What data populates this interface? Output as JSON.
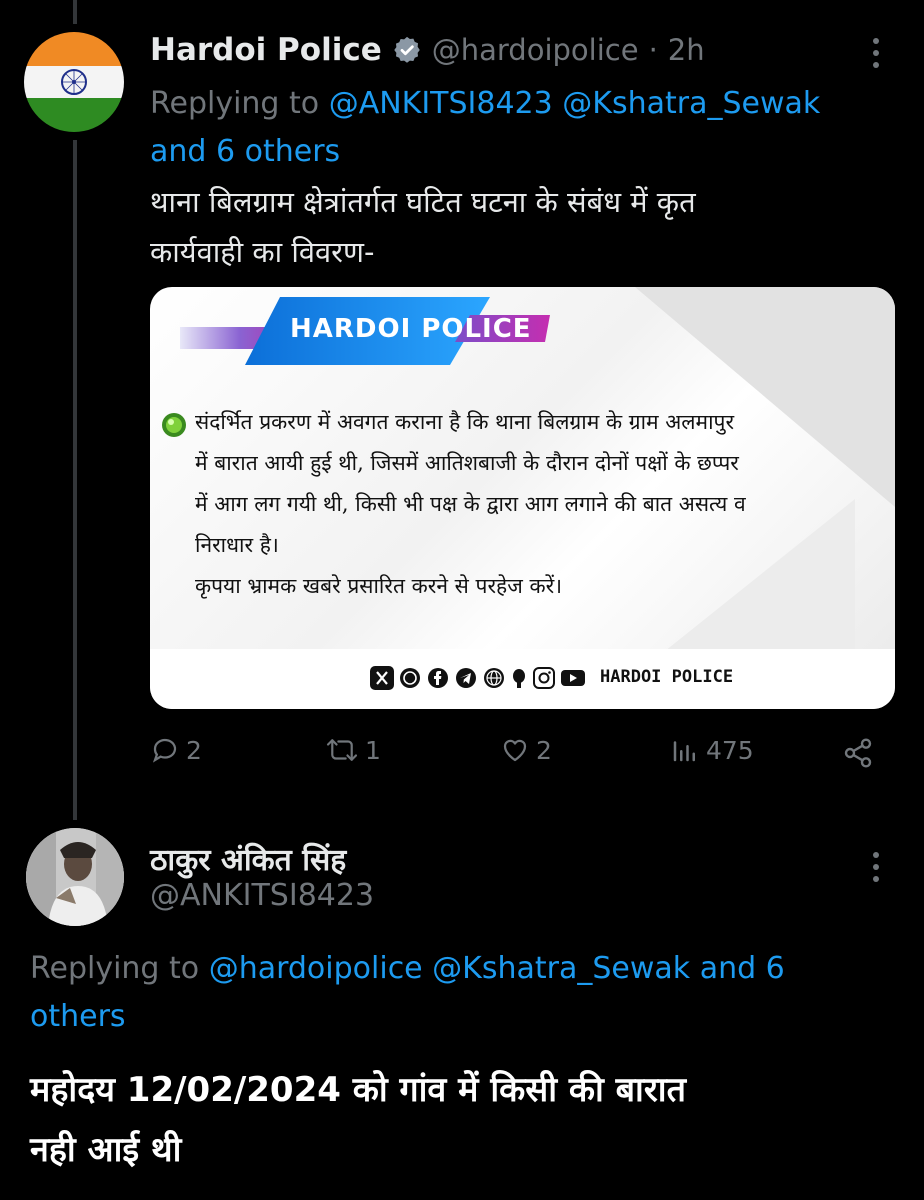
{
  "tweet1": {
    "display_name": "Hardoi Police",
    "handle": "@hardoipolice",
    "separator": "·",
    "time": "2h",
    "replying_prefix": "Replying to",
    "reply_line1": "@ANKITSI8423 @Kshatra_Sewak",
    "reply_line2": "and 6 others",
    "text_line1": "थाना बिलग्राम क्षेत्रांतर्गत घटित घटना के संबंध में कृत",
    "text_line2": "कार्यवाही का विवरण-",
    "card": {
      "banner": "HARDOI POLICE",
      "lines": [
        "संदर्भित प्रकरण में अवगत कराना है कि थाना बिलग्राम के ग्राम अलमापुर",
        "में बारात आयी हुई थी, जिसमें आतिशबाजी के दौरान दोनों पक्षों के छप्पर",
        "में आग लग गयी थी, किसी भी पक्ष के द्वारा आग लगाने की बात असत्य व",
        "निराधार है।",
        "कृपया भ्रामक खबरे प्रसारित करने से परहेज करें।"
      ],
      "footer_label": "HARDOI POLICE",
      "footer_icons": [
        "x-icon",
        "whatsapp-icon",
        "facebook-icon",
        "telegram-icon",
        "globe-icon",
        "koo-icon",
        "instagram-icon",
        "youtube-icon"
      ]
    },
    "stats": {
      "replies": "2",
      "reposts": "1",
      "likes": "2",
      "views": "475"
    },
    "colors": {
      "verified": "#8b98a5",
      "link": "#1d9bf0"
    }
  },
  "tweet2": {
    "display_name": "ठाकुर अंकित सिंह",
    "handle": "@ANKITSI8423",
    "replying_prefix": "Replying to",
    "reply_line1": "@hardoipolice @Kshatra_Sewak and 6",
    "reply_line2": "others",
    "text_line1": "महोदय 12/02/2024 को गांव में किसी की  बारात",
    "text_line2": "नही आई थी"
  }
}
